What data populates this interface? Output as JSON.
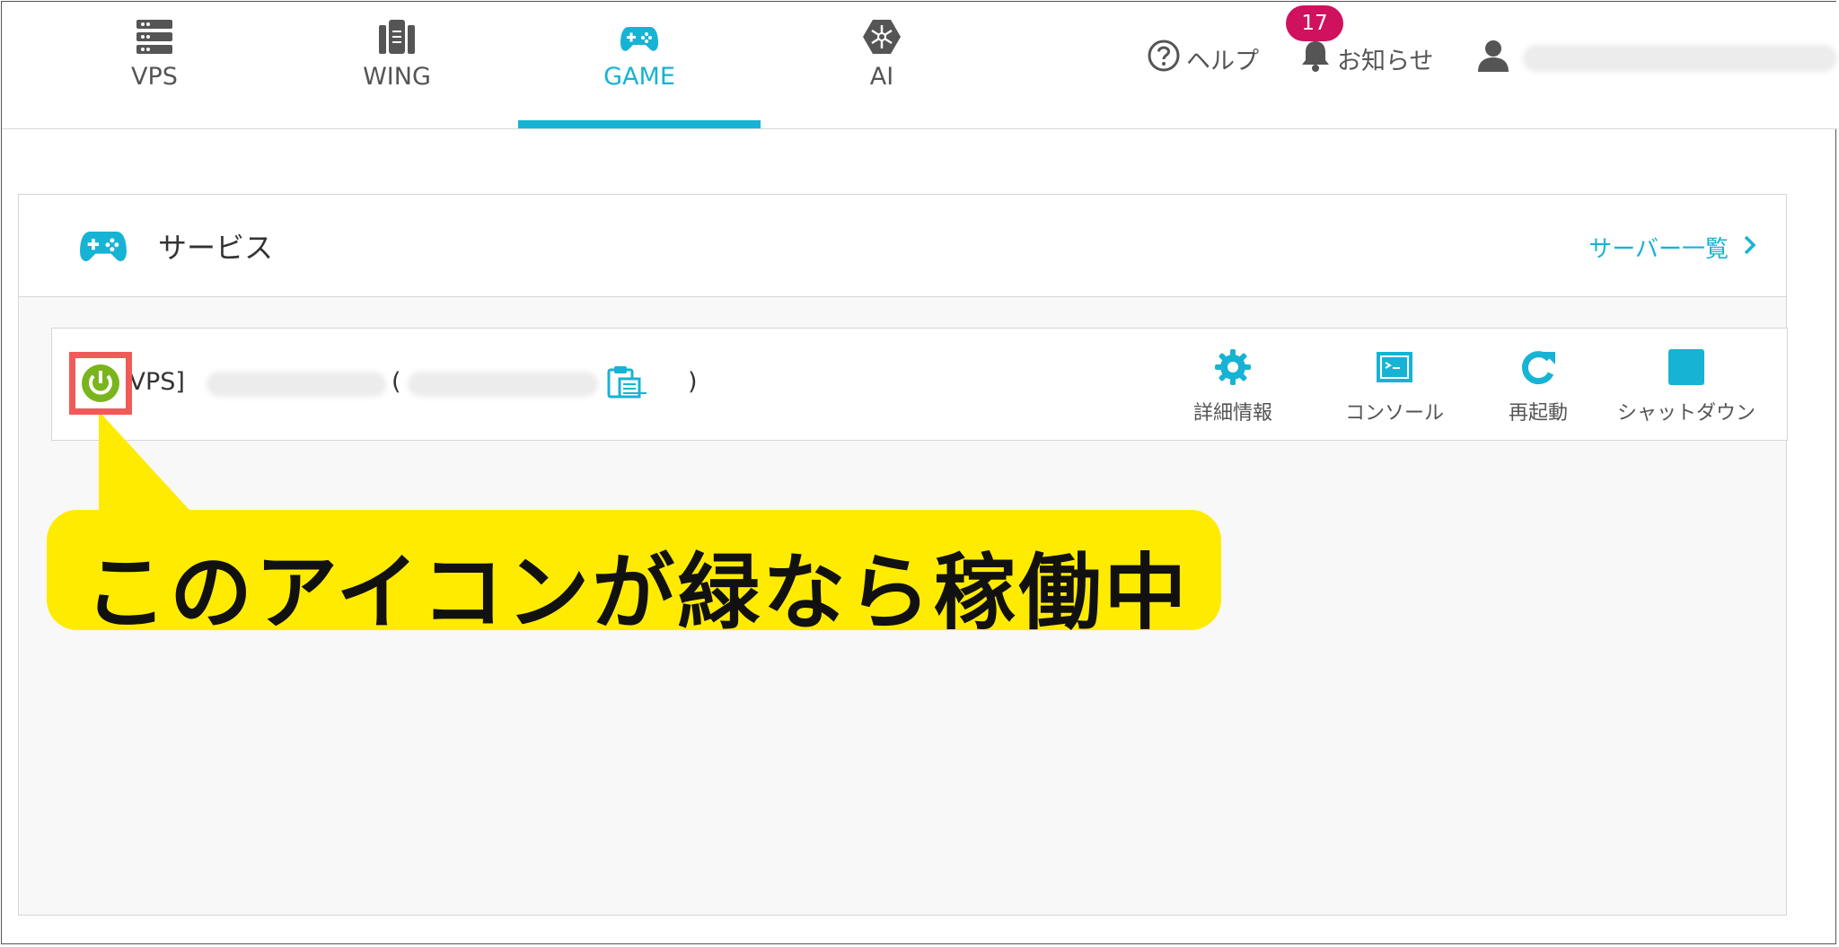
{
  "nav": {
    "tabs": [
      {
        "label": "VPS",
        "icon": "server-icon"
      },
      {
        "label": "WING",
        "icon": "wing-icon"
      },
      {
        "label": "GAME",
        "icon": "gamepad-icon",
        "active": true
      },
      {
        "label": "AI",
        "icon": "ai-chip-icon"
      }
    ],
    "help_label": "ヘルプ",
    "notice_label": "お知らせ",
    "notice_count": "17"
  },
  "panel": {
    "title": "サービス",
    "server_list_link": "サーバー一覧"
  },
  "server_row": {
    "type_label": "[VPS]",
    "paren_open": "(",
    "paren_close": ")",
    "status_color": "#7ab51d",
    "actions": [
      {
        "label": "詳細情報",
        "icon": "gear-icon"
      },
      {
        "label": "コンソール",
        "icon": "console-icon"
      },
      {
        "label": "再起動",
        "icon": "restart-icon"
      },
      {
        "label": "シャットダウン",
        "icon": "stop-icon"
      }
    ]
  },
  "callout": {
    "text": "このアイコンが緑なら稼働中"
  },
  "colors": {
    "accent": "#17b3d4",
    "badge": "#d0115e",
    "callout": "#ffeb00",
    "highlight": "#f25a5a"
  }
}
